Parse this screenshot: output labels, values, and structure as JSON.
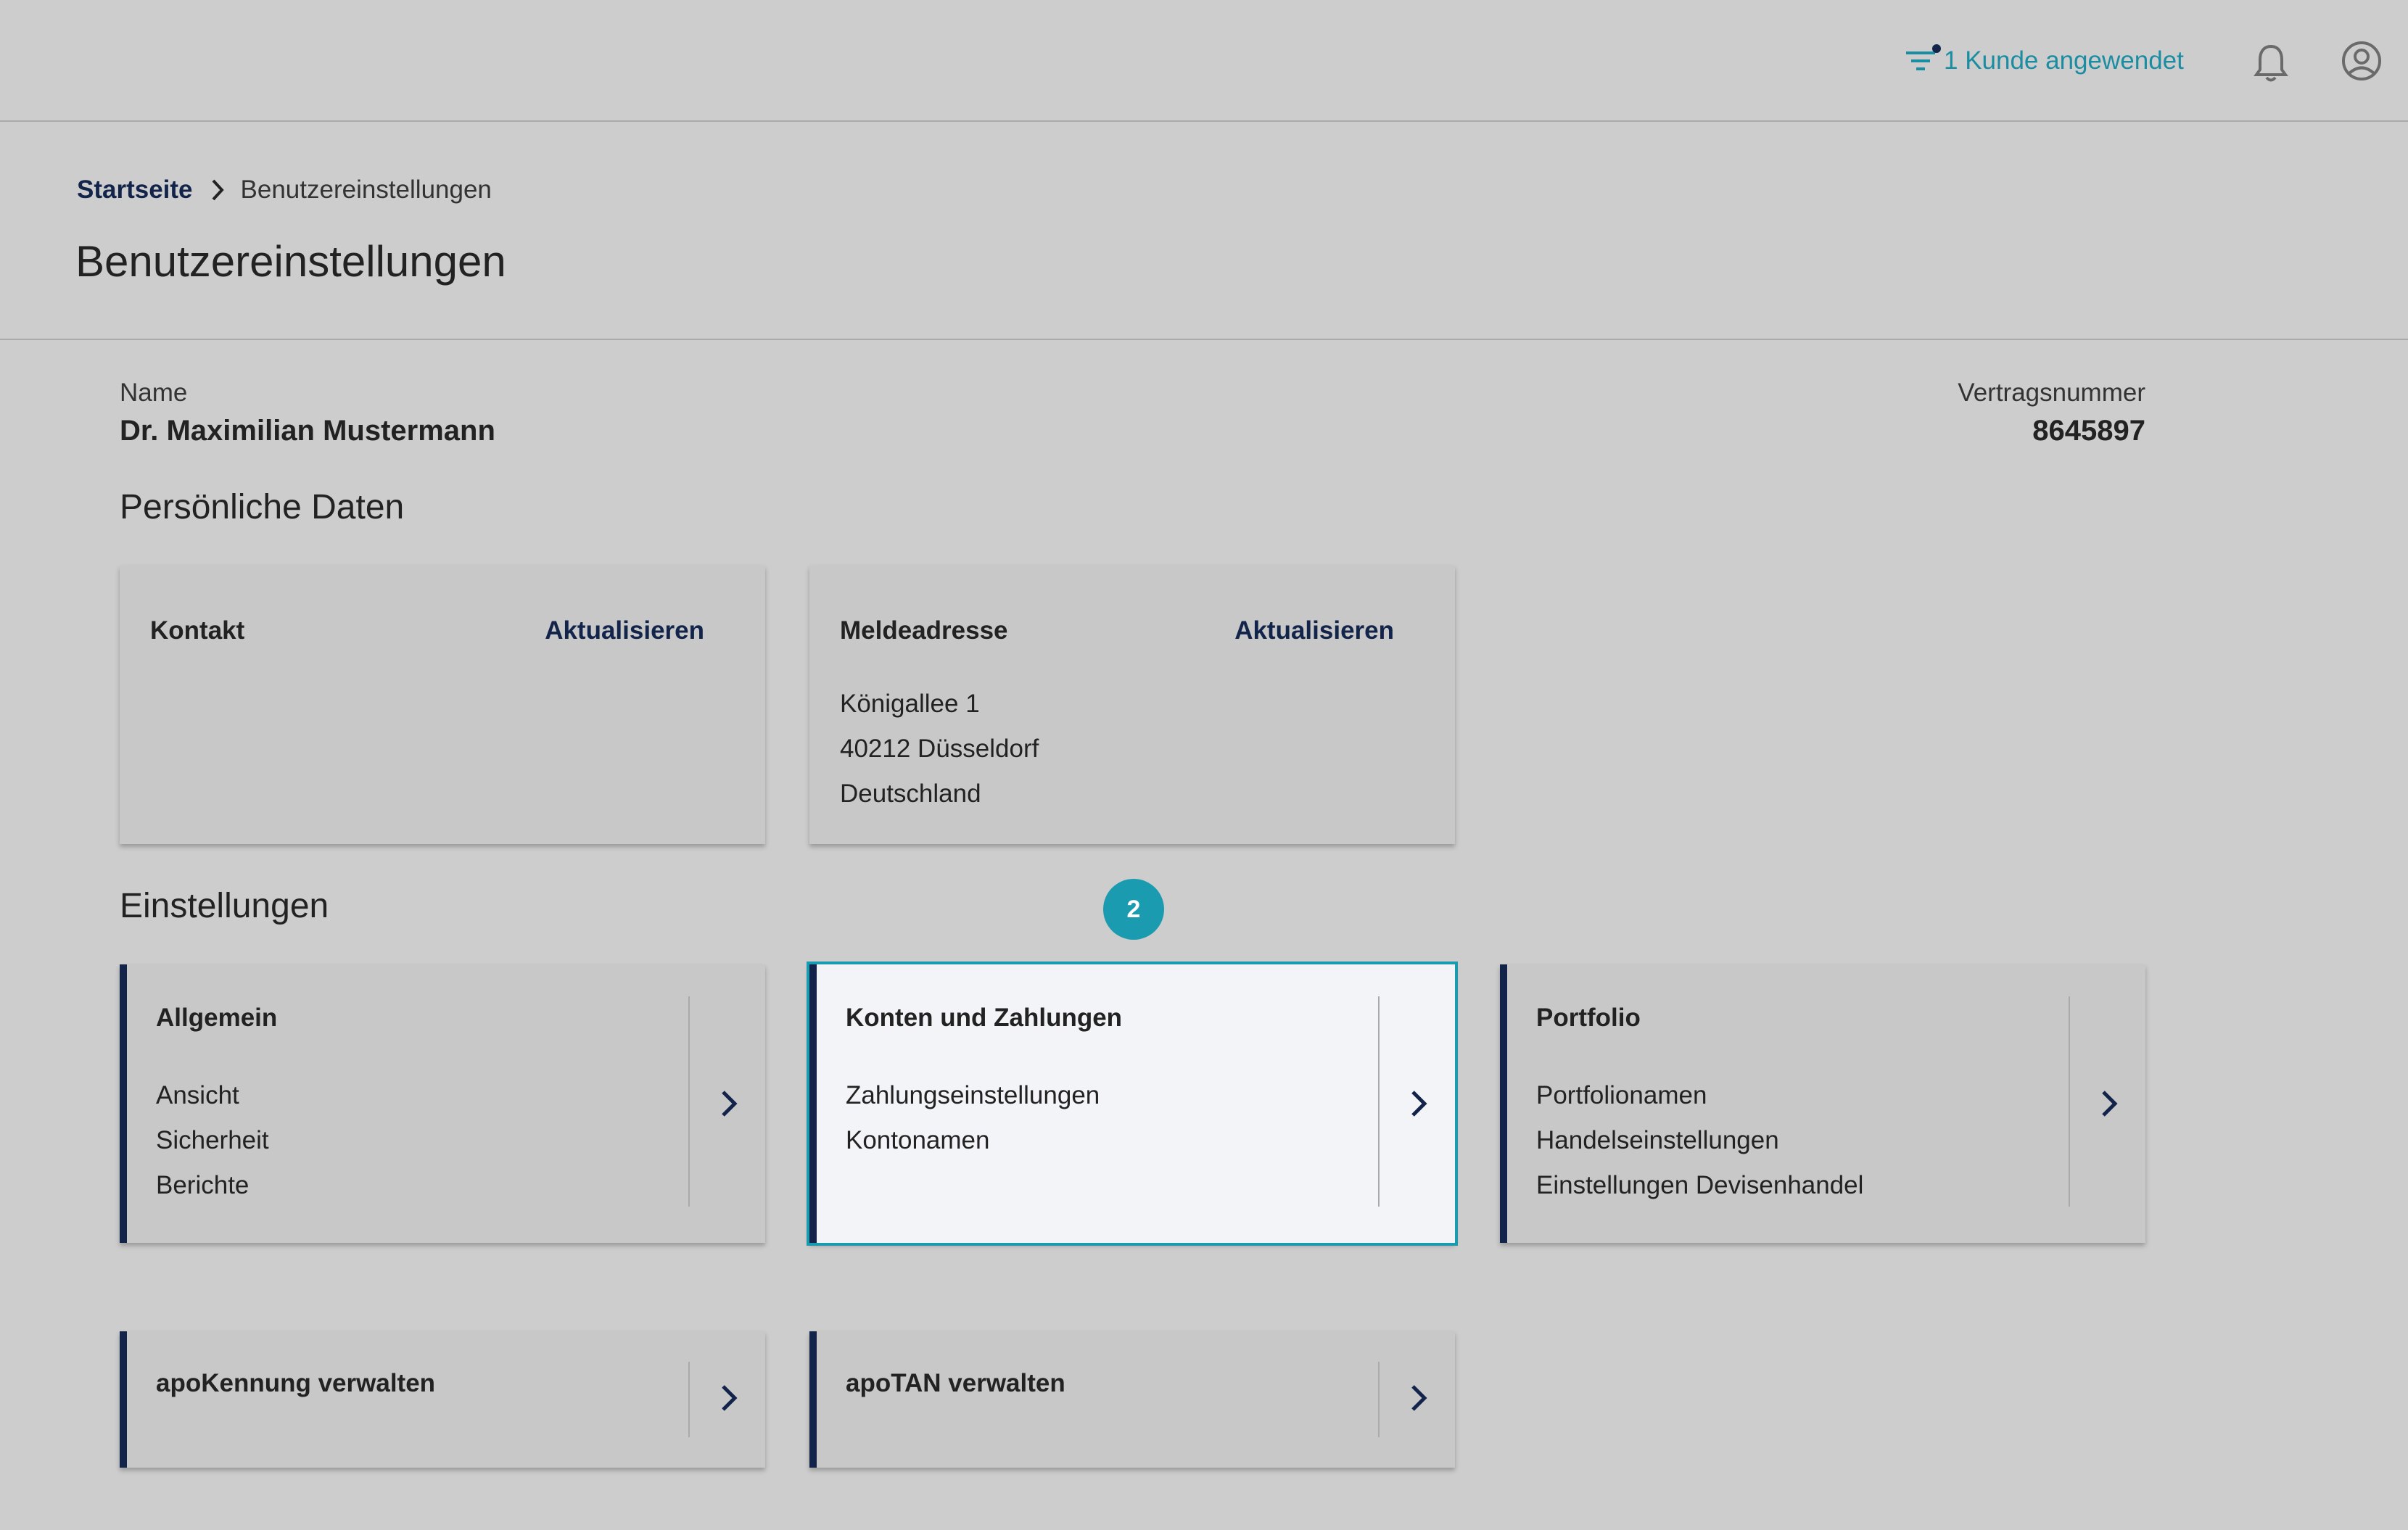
{
  "header": {
    "filter_label": "1 Kunde angewendet",
    "icons": {
      "filter": "filter-icon",
      "bell": "bell-icon",
      "user": "user-icon"
    },
    "accent_color": "#1b8da2"
  },
  "breadcrumb": {
    "home": "Startseite",
    "current": "Benutzereinstellungen"
  },
  "page_title": "Benutzereinstellungen",
  "user": {
    "name_label": "Name",
    "name": "Dr. Maximilian Mustermann",
    "contract_label": "Vertragsnummer",
    "contract_number": "8645897"
  },
  "personal": {
    "title": "Persönliche Daten",
    "contact": {
      "title": "Kontakt",
      "action": "Aktualisieren"
    },
    "address": {
      "title": "Meldeadresse",
      "action": "Aktualisieren",
      "lines": [
        "Königallee 1",
        "40212 Düsseldorf",
        "Deutschland"
      ]
    }
  },
  "settings": {
    "title": "Einstellungen",
    "step_badge": "2",
    "cards": [
      {
        "title": "Allgemein",
        "items": [
          "Ansicht",
          "Sicherheit",
          "Berichte"
        ]
      },
      {
        "title": "Konten und Zahlungen",
        "items": [
          "Zahlungseinstellungen",
          "Kontonamen"
        ]
      },
      {
        "title": "Portfolio",
        "items": [
          "Portfolionamen",
          "Handelseinstellungen",
          "Einstellungen Devisenhandel"
        ]
      }
    ],
    "security_cards": [
      {
        "title": "apoKennung verwalten"
      },
      {
        "title": "apoTAN verwalten"
      }
    ]
  },
  "colors": {
    "brand_dark": "#13244b",
    "highlight": "#1a9bb0"
  }
}
